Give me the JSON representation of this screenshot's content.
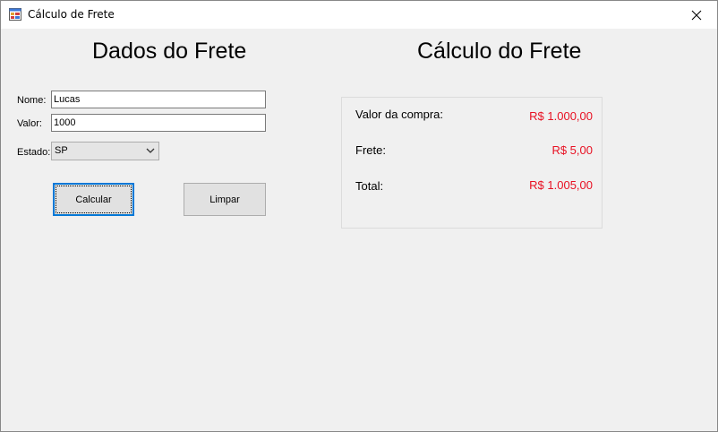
{
  "window": {
    "title": "Cálculo de Frete",
    "close_glyph": "✕"
  },
  "left": {
    "heading": "Dados do Frete",
    "nome_label": "Nome:",
    "nome_value": "Lucas",
    "valor_label": "Valor:",
    "valor_value": "1000",
    "estado_label": "Estado:",
    "estado_value": "SP",
    "calcular_label": "Calcular",
    "limpar_label": "Limpar"
  },
  "right": {
    "heading": "Cálculo do Frete",
    "compra_label": "Valor da compra:",
    "compra_value": "R$ 1.000,00",
    "frete_label": "Frete:",
    "frete_value": "R$ 5,00",
    "total_label": "Total:",
    "total_value": "R$ 1.005,00"
  },
  "colors": {
    "value_red": "#e81123",
    "focus_blue": "#0078d7",
    "form_bg": "#f0f0f0"
  }
}
